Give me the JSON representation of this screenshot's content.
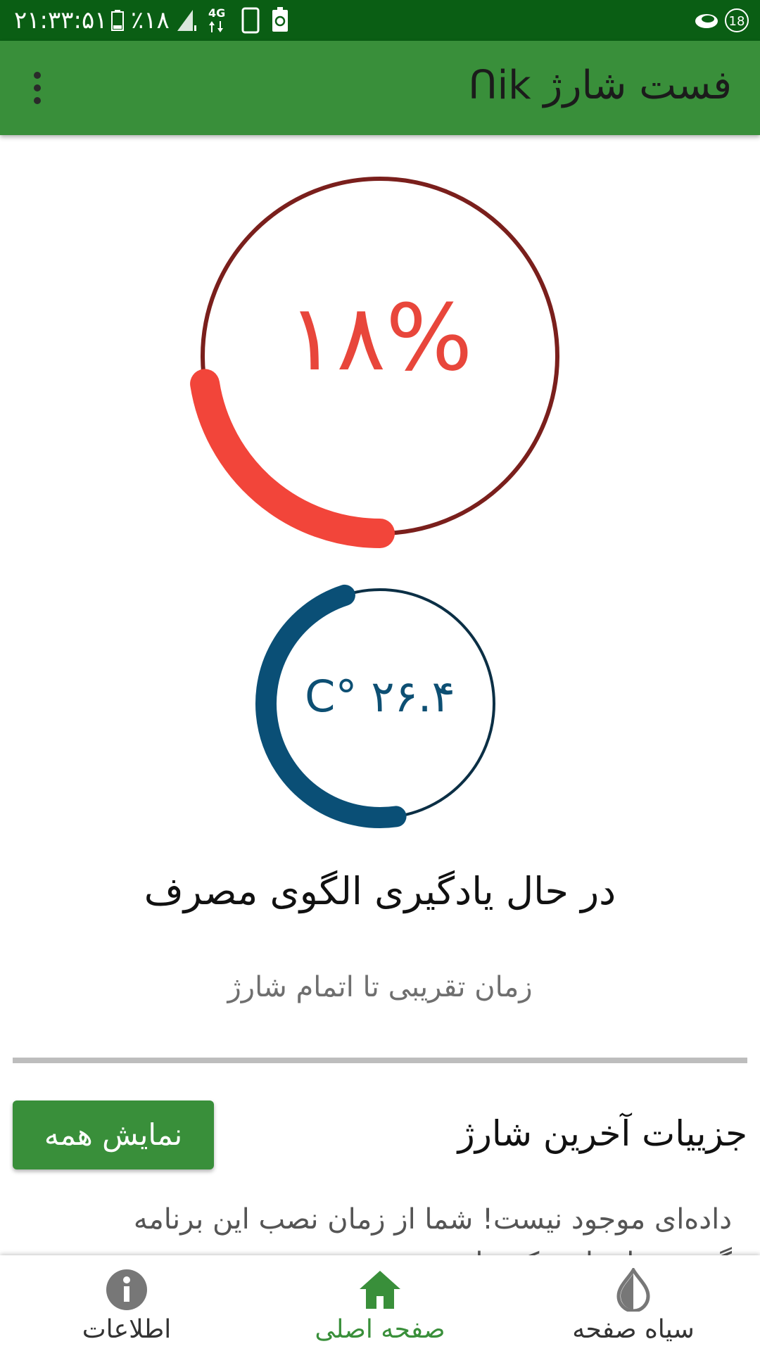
{
  "status_bar": {
    "time": "۲۱:۳۳:۵۱",
    "battery": "٪۱۸",
    "network": "4G",
    "notification_count": "18"
  },
  "app_bar": {
    "title": "فست شارژ Ոik",
    "menu_icon": "more-vert-icon"
  },
  "battery_gauge": {
    "percent_text": "۱۸%",
    "level": 0.18,
    "ring_color": "#7a1f1c",
    "progress_color": "#f2453a"
  },
  "temperature_gauge": {
    "text": "۲۶.۴ °C",
    "ring_color": "#0b2f45",
    "progress_color": "#0a4f76"
  },
  "status_message": "در حال یادگیری الگوی مصرف",
  "eta_label": "زمان تقریبی تا اتمام شارژ",
  "details_section": {
    "title": "جزییات آخرین شارژ",
    "show_all_label": "نمایش همه",
    "empty_message": "داده‌ای موجود نیست! شما از زمان نصب این برنامه گوشی را شارژ نکرده‌اید."
  },
  "bottom_nav": {
    "items": [
      {
        "label": "اطلاعات",
        "icon": "info-icon",
        "active": false
      },
      {
        "label": "صفحه اصلی",
        "icon": "home-icon",
        "active": true
      },
      {
        "label": "سیاه صفحه",
        "icon": "invert-colors-icon",
        "active": false
      }
    ],
    "active_color": "#398f3a",
    "inactive_color": "#333333"
  }
}
